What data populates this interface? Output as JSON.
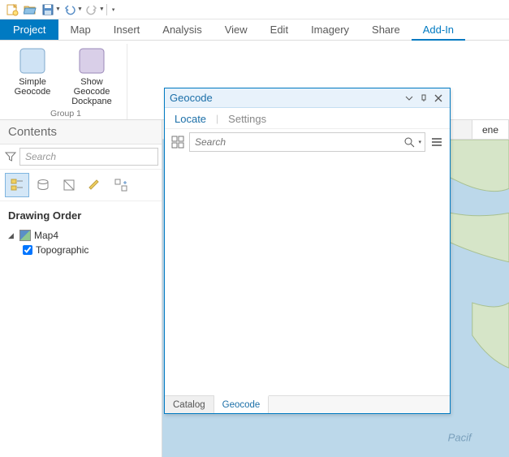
{
  "qat": {
    "items": [
      "new",
      "open",
      "save",
      "undo",
      "redo"
    ]
  },
  "ribbon": {
    "tabs": {
      "file": "Project",
      "map": "Map",
      "insert": "Insert",
      "analysis": "Analysis",
      "view": "View",
      "edit": "Edit",
      "imagery": "Imagery",
      "share": "Share",
      "addin": "Add-In"
    },
    "active_tab": "addin",
    "group1": {
      "name": "Group 1",
      "simple_geocode": "Simple Geocode",
      "show_dockpane": "Show Geocode Dockpane"
    }
  },
  "contents": {
    "title": "Contents",
    "search_placeholder": "Search",
    "drawing_order": "Drawing Order",
    "map_name": "Map4",
    "layer_name": "Topographic",
    "layer_checked": true
  },
  "map_view": {
    "visible_tab": "ene",
    "ocean_label": "Pacif"
  },
  "dockpane": {
    "title": "Geocode",
    "subtabs": {
      "locate": "Locate",
      "settings": "Settings",
      "active": "locate"
    },
    "search_placeholder": "Search",
    "bottom_tabs": {
      "catalog": "Catalog",
      "geocode": "Geocode",
      "active": "geocode"
    }
  },
  "colors": {
    "accent": "#007ac2",
    "pane_accent": "#1b6fa8"
  }
}
